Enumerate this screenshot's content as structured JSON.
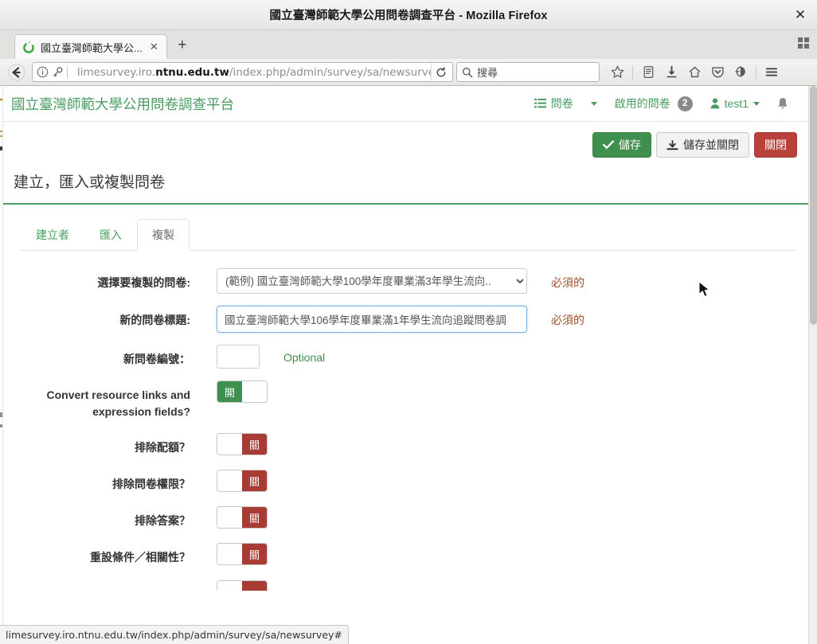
{
  "browser": {
    "window_title": "國立臺灣師範大學公用問卷調查平台 - Mozilla Firefox",
    "close_glyph": "✕",
    "tab": {
      "title": "國立臺灣師範大學公...",
      "close_glyph": "✕",
      "favicon_name": "limesurvey-favicon"
    },
    "new_tab_glyph": "+",
    "url_prefix": "limesurvey.iro.",
    "url_domain": "ntnu.edu.tw",
    "url_suffix": "/index.php/admin/survey/sa/newsurvey",
    "search_placeholder": "搜尋",
    "reload_glyph": "⟳",
    "toolbar_icons": [
      "bookmark-star-icon",
      "library-icon",
      "downloads-icon",
      "home-icon",
      "pocket-icon",
      "sync-icon",
      "menu-hamburger-icon"
    ]
  },
  "statusbar": {
    "link_url": "limesurvey.iro.ntnu.edu.tw/index.php/admin/survey/sa/newsurvey#"
  },
  "topnav": {
    "brand": "國立臺灣師範大學公用問卷調查平台",
    "surveys_label": "問卷",
    "active_surveys_label": "啟用的問卷",
    "active_surveys_count": "2",
    "user_label": "test1",
    "bell_icon": "notification-bell-icon"
  },
  "toolbar": {
    "save_label": "儲存",
    "save_and_close_label": "儲存並關閉",
    "close_label": "關閉"
  },
  "page": {
    "title": "建立，匯入或複製問卷"
  },
  "tabs": [
    {
      "label": "建立者",
      "active": false
    },
    {
      "label": "匯入",
      "active": false
    },
    {
      "label": "複製",
      "active": true
    }
  ],
  "form": {
    "rows": [
      {
        "label": "選擇要複製的問卷:",
        "type": "select",
        "value": "(範例) 國立臺灣師範大學100學年度畢業滿3年學生流向..",
        "help": "必須的",
        "help_kind": "required",
        "name": "source-survey-select"
      },
      {
        "label": "新的問卷標題:",
        "type": "text",
        "value": "國立臺灣師範大學106學年度畢業滿1年學生流向追蹤問卷調",
        "help": "必須的",
        "help_kind": "required",
        "name": "new-survey-title-input"
      },
      {
        "label": "新問卷編號：",
        "type": "small-text",
        "value": "",
        "help": "Optional",
        "help_kind": "optional",
        "name": "new-survey-id-input"
      },
      {
        "label": "Convert resource links and expression fields?",
        "type": "toggle",
        "state": "on",
        "on_text": "開",
        "off_text": "關",
        "name": "convert-resource-links-toggle"
      },
      {
        "label": "排除配額？",
        "type": "toggle",
        "state": "off",
        "on_text": "開",
        "off_text": "關",
        "name": "exclude-quotas-toggle"
      },
      {
        "label": "排除問卷權限？",
        "type": "toggle",
        "state": "off",
        "on_text": "開",
        "off_text": "關",
        "name": "exclude-survey-permissions-toggle"
      },
      {
        "label": "排除答案？",
        "type": "toggle",
        "state": "off",
        "on_text": "開",
        "off_text": "關",
        "name": "exclude-answers-toggle"
      },
      {
        "label": "重設條件／相關性？",
        "type": "toggle",
        "state": "off",
        "on_text": "開",
        "off_text": "關",
        "name": "reset-conditions-toggle"
      },
      {
        "label": "",
        "type": "toggle-partial",
        "state": "off",
        "on_text": "",
        "off_text": "",
        "name": "next-option-toggle"
      }
    ]
  },
  "colors": {
    "brand_green": "#4a9c63",
    "success": "#3f8f4f",
    "danger": "#b8413c",
    "required_text": "#a0522d"
  }
}
